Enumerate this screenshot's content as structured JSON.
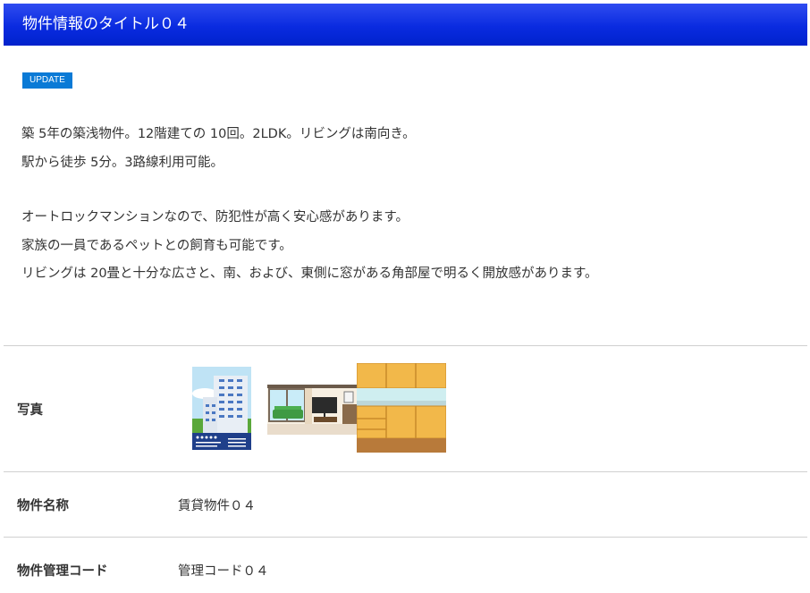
{
  "header": {
    "title": "物件情報のタイトル０４"
  },
  "badge": {
    "label": "UPDATE"
  },
  "description": [
    "築 5年の築浅物件。12階建ての 10回。2LDK。リビングは南向き。",
    "駅から徒歩 5分。3路線利用可能。",
    "オートロックマンションなので、防犯性が高く安心感があります。",
    "家族の一員であるペットとの飼育も可能です。",
    "リビングは 20畳と十分な広さと、南、および、東側に窓がある角部屋で明るく開放感があります。"
  ],
  "details": {
    "photo_label": "写真",
    "name_label": "物件名称",
    "name_value": "賃貸物件０４",
    "code_label": "物件管理コード",
    "code_value": "管理コード０４"
  },
  "photos": [
    {
      "icon": "apartment-building-flyer-icon"
    },
    {
      "icon": "living-room-icon"
    },
    {
      "icon": "kitchen-cabinets-icon"
    }
  ],
  "colors": {
    "title_bar": "#0a2be0",
    "badge": "#0a7ad6",
    "divider": "#d0d0d0"
  }
}
